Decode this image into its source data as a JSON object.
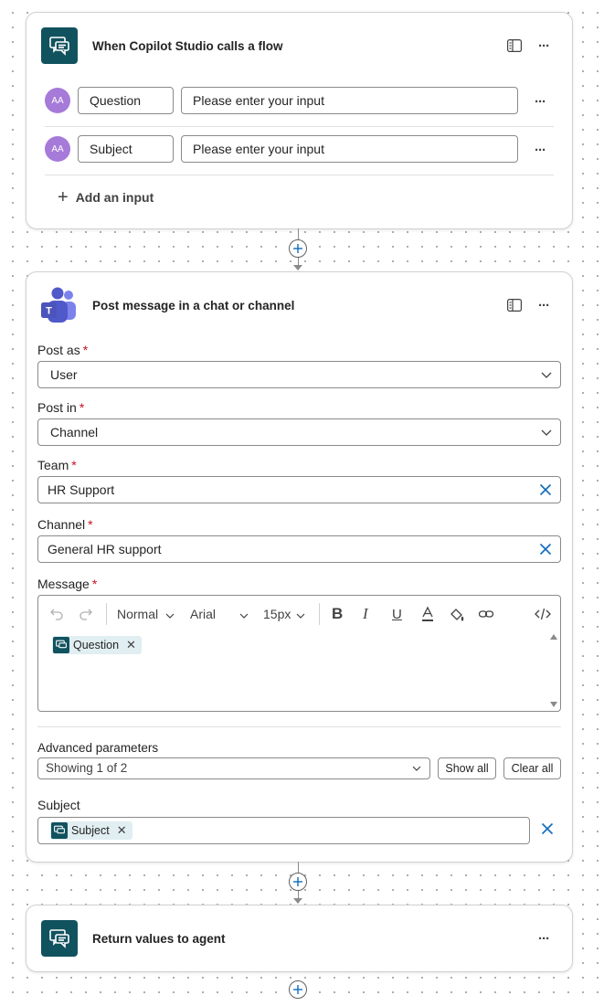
{
  "trigger_card": {
    "title": "When Copilot Studio calls a flow",
    "inputs": [
      {
        "avatar": "AA",
        "name": "Question",
        "placeholder": "Please enter your input"
      },
      {
        "avatar": "AA",
        "name": "Subject",
        "placeholder": "Please enter your input"
      }
    ],
    "add_input_label": "Add an input"
  },
  "post_card": {
    "title": "Post message in a chat or channel",
    "post_as": {
      "label": "Post as",
      "required": "*",
      "value": "User"
    },
    "post_in": {
      "label": "Post in",
      "required": "*",
      "value": "Channel"
    },
    "team": {
      "label": "Team",
      "required": "*",
      "value": "HR Support"
    },
    "channel": {
      "label": "Channel",
      "required": "*",
      "value": "General HR support"
    },
    "message": {
      "label": "Message",
      "required": "*",
      "toolbar": {
        "style": "Normal",
        "font": "Arial",
        "size": "15px"
      },
      "token": "Question"
    },
    "advanced": {
      "label": "Advanced parameters",
      "showing": "Showing 1 of 2",
      "show_all": "Show all",
      "clear_all": "Clear all"
    },
    "subject": {
      "label": "Subject",
      "token": "Subject"
    }
  },
  "return_card": {
    "title": "Return values to agent"
  },
  "colors": {
    "accent": "#11525f",
    "avatar": "#a67ad9",
    "required": "#c50f1f",
    "clear_x": "#0f6cbd",
    "add_circle": "#0f6cbd"
  },
  "icons": {
    "flow_card": "copilot-chat-icon",
    "teams": "teams-icon",
    "info_panel": "info-panel-icon",
    "more": "more-icon"
  }
}
